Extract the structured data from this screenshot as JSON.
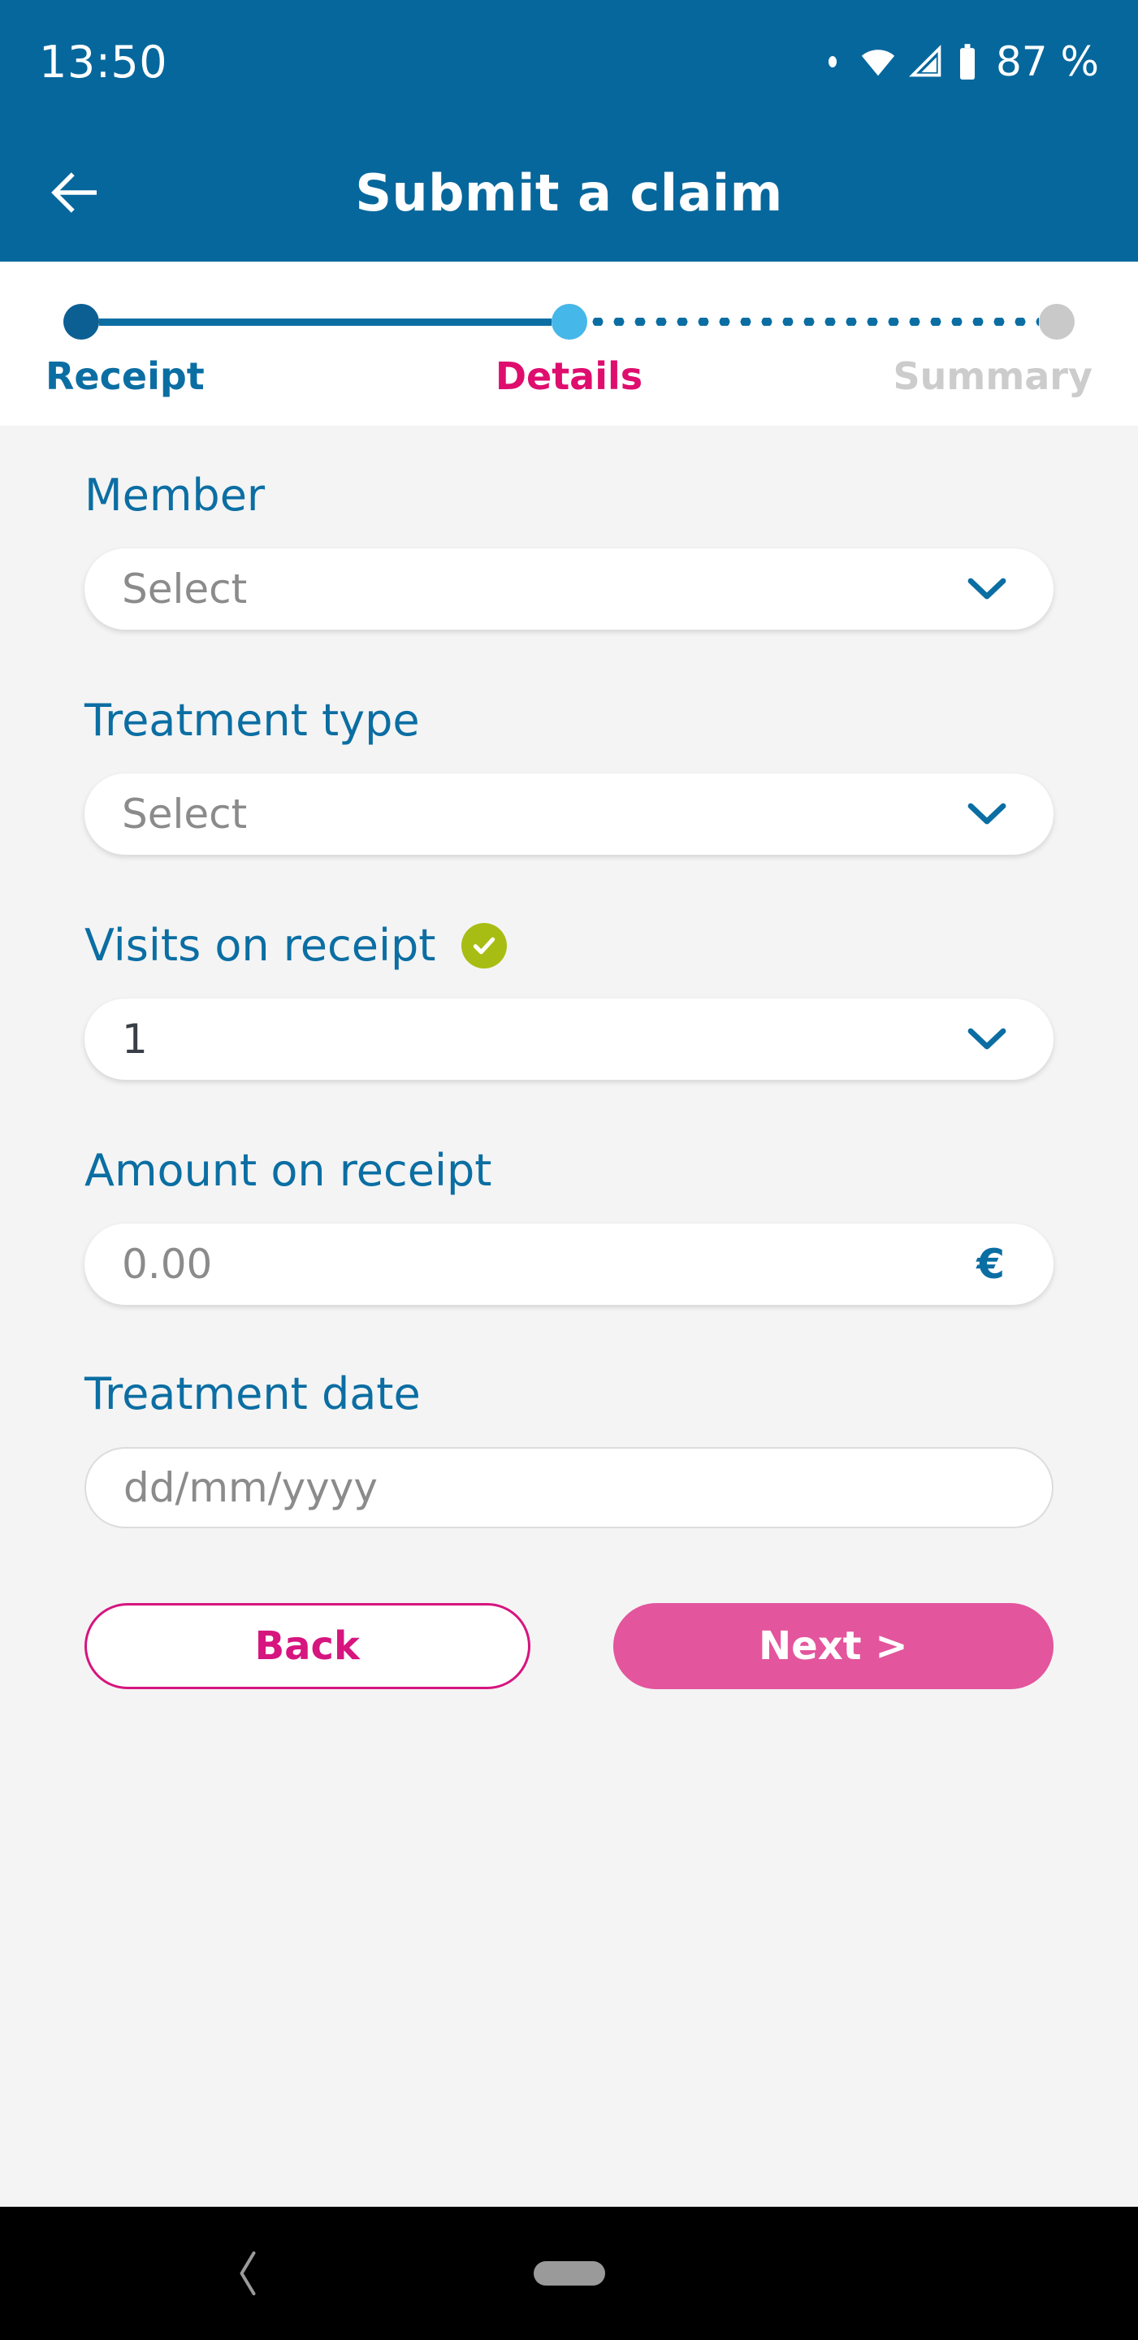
{
  "status_bar": {
    "time": "13:50",
    "battery_text": "87 %",
    "icons": [
      "dot-indicator-icon",
      "wifi-icon",
      "cell-signal-icon",
      "battery-icon"
    ]
  },
  "app_bar": {
    "title": "Submit a claim",
    "back_icon": "arrow-left-icon"
  },
  "stepper": {
    "steps": [
      {
        "label": "Receipt",
        "state": "done",
        "color": "#0b6ea3"
      },
      {
        "label": "Details",
        "state": "active",
        "color": "#de0d6e"
      },
      {
        "label": "Summary",
        "state": "todo",
        "color": "#cccccc"
      }
    ]
  },
  "form": {
    "fields": [
      {
        "label": "Member",
        "type": "select",
        "value": "",
        "placeholder": "Select",
        "validated": false
      },
      {
        "label": "Treatment type",
        "type": "select",
        "value": "",
        "placeholder": "Select",
        "validated": false
      },
      {
        "label": "Visits on receipt",
        "type": "select",
        "value": "1",
        "placeholder": "",
        "validated": true
      },
      {
        "label": "Amount on receipt",
        "type": "currency",
        "value": "",
        "placeholder": "0.00",
        "suffix": "€",
        "validated": false
      },
      {
        "label": "Treatment date",
        "type": "date",
        "value": "",
        "placeholder": "dd/mm/yyyy",
        "validated": false
      }
    ]
  },
  "actions": {
    "back_label": "Back",
    "next_label": "Next >"
  },
  "nav_bar": {
    "back_icon": "chevron-left-icon",
    "home_icon": "home-pill-icon"
  },
  "colors": {
    "brand_blue": "#06679c",
    "link_blue": "#0b6ea3",
    "accent_pink": "#de0d6e",
    "next_pink": "#e3559c",
    "valid_green": "#a8bd13",
    "muted_gray": "#cccccc",
    "page_bg": "#f4f4f4"
  }
}
